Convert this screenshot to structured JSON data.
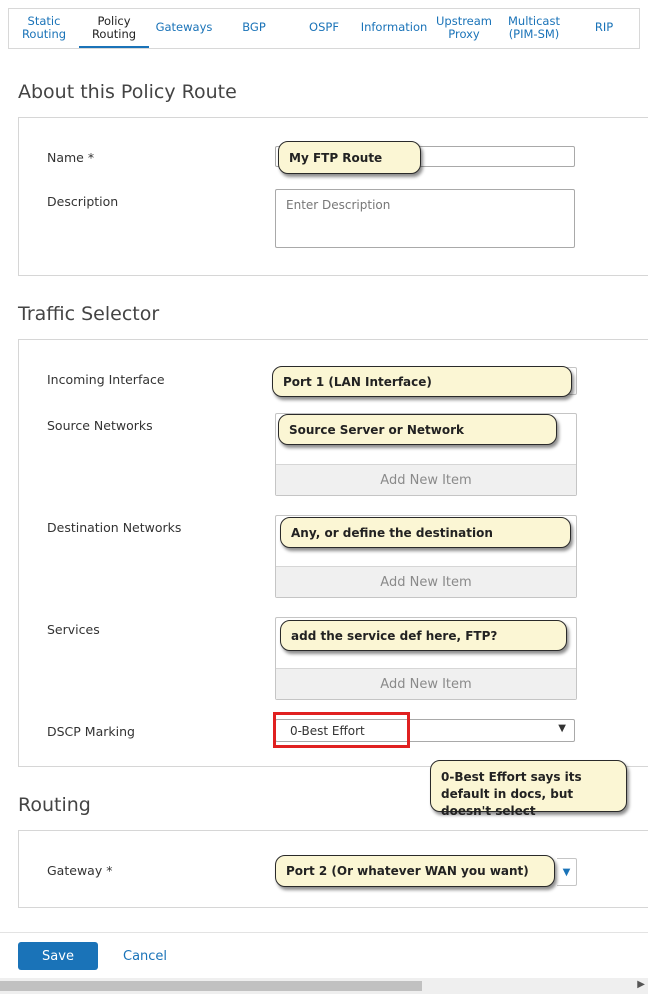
{
  "tabs": [
    {
      "label": "Static\nRouting",
      "active": false
    },
    {
      "label": "Policy\nRouting",
      "active": true
    },
    {
      "label": "Gateways",
      "active": false
    },
    {
      "label": "BGP",
      "active": false
    },
    {
      "label": "OSPF",
      "active": false
    },
    {
      "label": "Information",
      "active": false
    },
    {
      "label": "Upstream\nProxy",
      "active": false
    },
    {
      "label": "Multicast\n(PIM-SM)",
      "active": false
    },
    {
      "label": "RIP",
      "active": false
    }
  ],
  "about": {
    "title": "About this Policy Route",
    "name_label": "Name *",
    "description_label": "Description",
    "description_placeholder": "Enter Description"
  },
  "traffic": {
    "title": "Traffic Selector",
    "incoming_label": "Incoming Interface",
    "source_label": "Source Networks",
    "destination_label": "Destination Networks",
    "services_label": "Services",
    "dscp_label": "DSCP Marking",
    "add_new_item": "Add New Item",
    "dscp_value": "0-Best Effort"
  },
  "routing": {
    "title": "Routing",
    "gateway_label": "Gateway *"
  },
  "footer": {
    "save_label": "Save",
    "cancel_label": "Cancel"
  },
  "callouts": {
    "name": "My FTP Route",
    "incoming": "Port 1 (LAN Interface)",
    "source": "Source Server or Network",
    "destination": "Any, or define the destination",
    "services": "add the service def here, FTP?",
    "dscp_note": "0-Best Effort says its default in docs, but doesn't select",
    "gateway": "Port 2 (Or whatever WAN you want)"
  },
  "colors": {
    "accent": "#1a73b8",
    "callout_bg": "#fbf6d4",
    "highlight_red": "#e02020"
  }
}
